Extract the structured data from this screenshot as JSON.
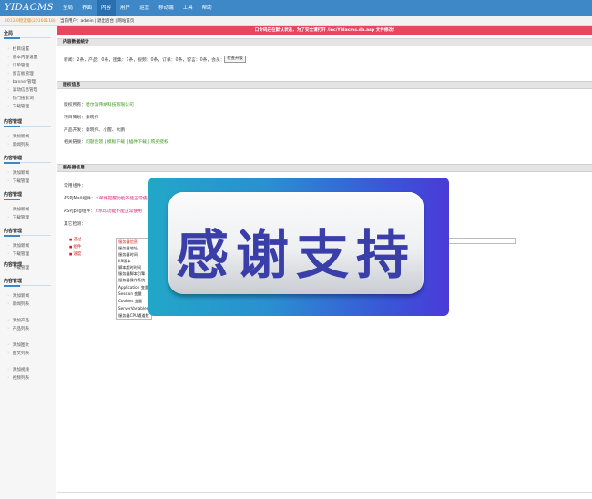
{
  "logo": "YIDACMS",
  "nav": [
    "全局",
    "界面",
    "内容",
    "用户",
    "运营",
    "移动端",
    "工具",
    "帮助"
  ],
  "nav_active": 2,
  "version": "2013.0稳定版(20160118)",
  "userbar": "当前用户：admin | 退出后台 | 网站首页",
  "sidebar": {
    "sections": [
      {
        "title": "全局",
        "items": [
          "栏目设置",
          "基本内容设置",
          "订单管理",
          "留言板管理",
          "banner管理",
          "滚动信息管理",
          "热门搜索词",
          "下载管理"
        ]
      },
      {
        "title": "内容管理",
        "items": [
          "添加新闻",
          "新闻列表"
        ]
      },
      {
        "title": "内容管理",
        "items": [
          "添加新闻",
          "下载管理"
        ]
      },
      {
        "title": "内容管理",
        "items": [
          "添加新闻",
          "下载管理"
        ]
      },
      {
        "title": "内容管理",
        "items": [
          "添加新闻",
          "下载管理"
        ]
      },
      {
        "title": "内容管理",
        "items": [
          "下载管理"
        ]
      },
      {
        "title": "内容管理",
        "items": [
          "添加新闻",
          "新闻列表",
          "添加产品",
          "产品列表",
          "添加图文",
          "图文列表",
          "添加视频",
          "视频列表"
        ]
      }
    ]
  },
  "alert": "口令码还在默认状态，为了安全请打开 /inc/Yidacms.db.asp 文件修改!",
  "stats": {
    "title": "内容数据统计",
    "line": "新闻：2条，产品：0条，图集：1条，视频：0条，订单：0条，留言：0条，会员：0位",
    "button": "检查升级"
  },
  "copyright": {
    "title": "版权信息",
    "owner_label": "版权所有：",
    "owner": "哈尔滨伟纳科技有限公司",
    "support_label": "项目策划：",
    "support": "秦晓伟",
    "dev_label": "产品开发：",
    "dev": "秦晓伟、小醒、大鹏",
    "links_label": "相关链接：",
    "links": "问题反馈 | 模板下载 | 插件下载 | 购买授权"
  },
  "server": {
    "title": "服务器信息",
    "host_label": "常用组件：",
    "jmail_label": "ASPJMail组件：",
    "jmail": "×邮件提醒功能不能正常使用",
    "jpeg_label": "ASPJpeg组件：",
    "jpeg": "×水印功能不能正常使用",
    "other_label": "其它检测：",
    "legend": [
      "通过",
      "组件",
      "速度"
    ],
    "list": [
      "服务器信息",
      "服务器地址",
      "服务器时间",
      "IIS版本",
      "脚本超时时间",
      "服务器脚本引擎",
      "服务器操作系统",
      "Application 变量",
      "Session 变量",
      "Cookies 变量",
      "ServerVariables",
      "服务器CPU通道数"
    ]
  },
  "overlay_text": "感谢支持",
  "colors": {
    "nav_bg": "#3f88c8",
    "alert_bg": "#e8465e",
    "link_green": "#3a9a1a",
    "warn_red": "#e0227e"
  }
}
